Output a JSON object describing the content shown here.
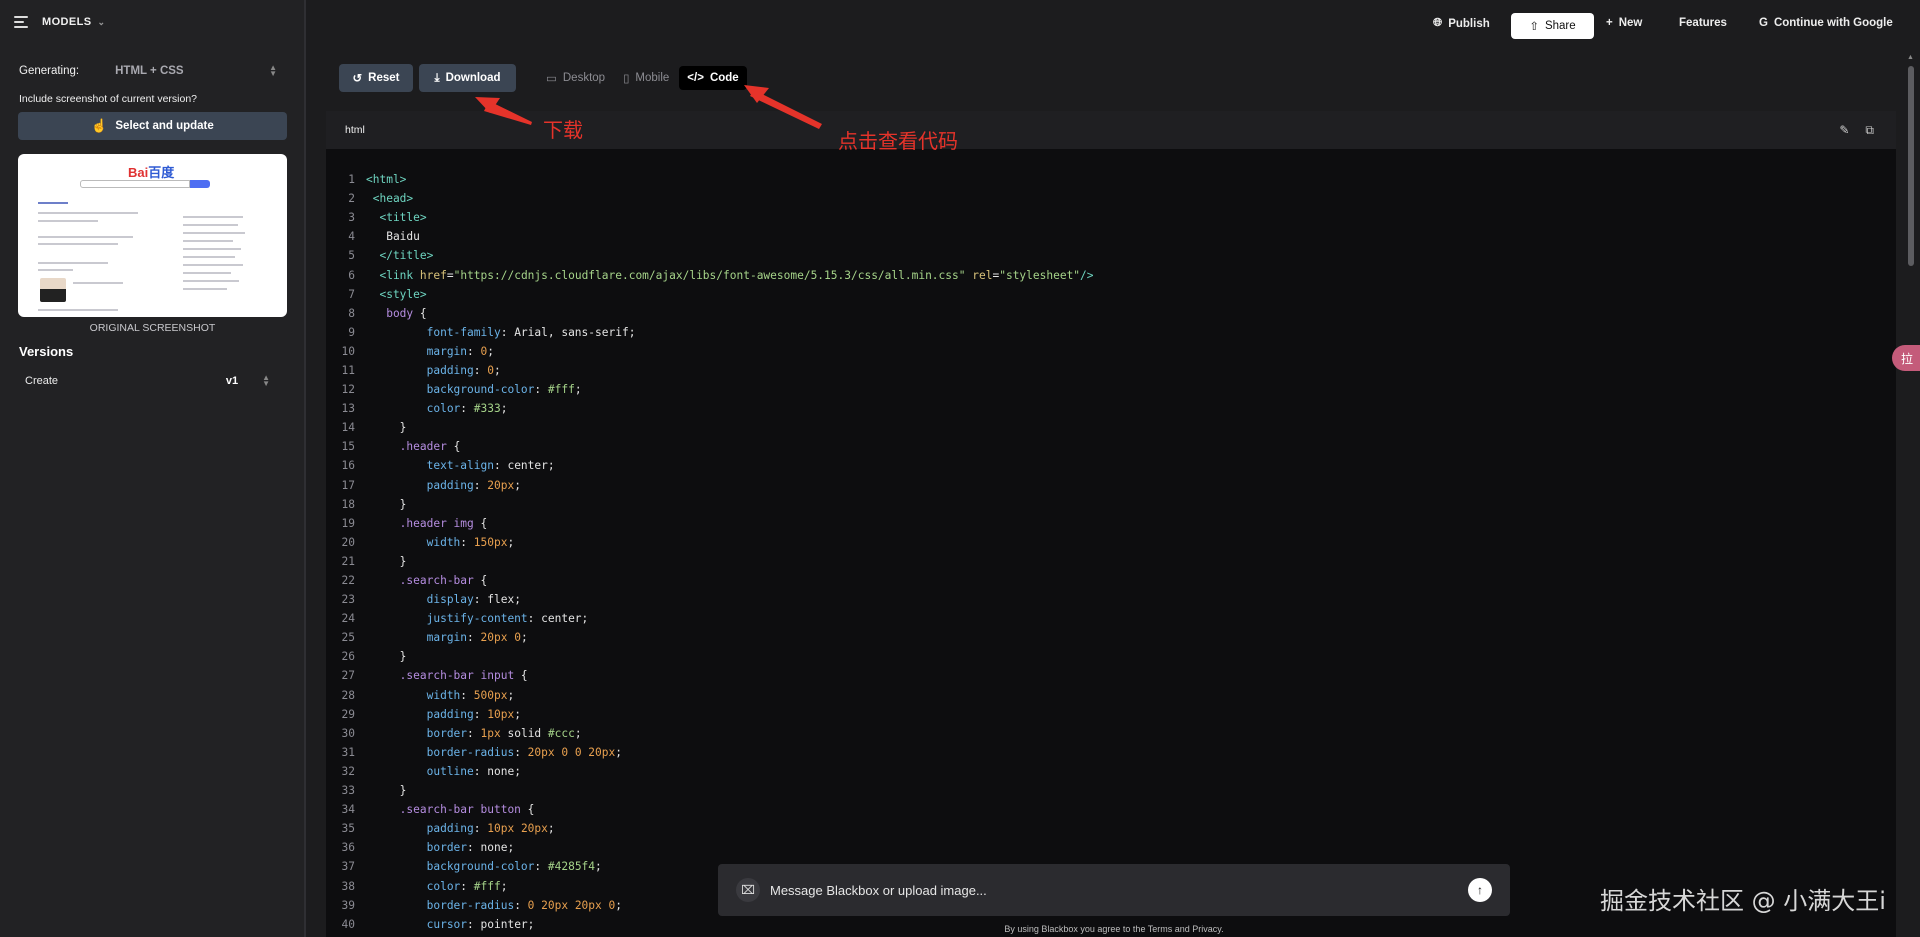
{
  "sidebar": {
    "models_label": "MODELS",
    "generating_label": "Generating:",
    "generating_value": "HTML + CSS",
    "include_prompt": "Include screenshot of current version?",
    "select_update_label": "Select and update",
    "thumbnail_caption": "ORIGINAL SCREENSHOT",
    "versions_heading": "Versions",
    "version_action": "Create",
    "version_number": "v1"
  },
  "topbar": {
    "publish": "Publish",
    "share": "Share",
    "new": "New",
    "features": "Features",
    "google": "Continue with Google"
  },
  "toolbar": {
    "reset": "Reset",
    "download": "Download",
    "tabs": [
      "Desktop",
      "Mobile",
      "Code"
    ],
    "active_tab": "Code"
  },
  "code_panel": {
    "language": "html",
    "lines": [
      [
        [
          "tag",
          "<html>"
        ]
      ],
      [
        [
          "tag",
          " <head>"
        ]
      ],
      [
        [
          "tag",
          "  <title>"
        ]
      ],
      [
        [
          "plain",
          "   Baidu"
        ]
      ],
      [
        [
          "tag",
          "  </title>"
        ]
      ],
      [
        [
          "tag",
          "  <link "
        ],
        [
          "attr",
          "href"
        ],
        [
          "plain",
          "="
        ],
        [
          "str",
          "\"https://cdnjs.cloudflare.com/ajax/libs/font-awesome/5.15.3/css/all.min.css\""
        ],
        [
          "plain",
          " "
        ],
        [
          "attr",
          "rel"
        ],
        [
          "plain",
          "="
        ],
        [
          "str",
          "\"stylesheet\""
        ],
        [
          "tag",
          "/>"
        ]
      ],
      [
        [
          "tag",
          "  <style>"
        ]
      ],
      [
        [
          "sel",
          "   body "
        ],
        [
          "plain",
          "{"
        ]
      ],
      [
        [
          "prop",
          "         font-family"
        ],
        [
          "plain",
          ": Arial, sans-serif;"
        ]
      ],
      [
        [
          "prop",
          "         margin"
        ],
        [
          "plain",
          ": "
        ],
        [
          "num",
          "0"
        ],
        [
          "plain",
          ";"
        ]
      ],
      [
        [
          "prop",
          "         padding"
        ],
        [
          "plain",
          ": "
        ],
        [
          "num",
          "0"
        ],
        [
          "plain",
          ";"
        ]
      ],
      [
        [
          "prop",
          "         background-color"
        ],
        [
          "plain",
          ": "
        ],
        [
          "str",
          "#fff"
        ],
        [
          "plain",
          ";"
        ]
      ],
      [
        [
          "prop",
          "         color"
        ],
        [
          "plain",
          ": "
        ],
        [
          "str",
          "#333"
        ],
        [
          "plain",
          ";"
        ]
      ],
      [
        [
          "plain",
          "     }"
        ]
      ],
      [
        [
          "sel",
          "     .header "
        ],
        [
          "plain",
          "{"
        ]
      ],
      [
        [
          "prop",
          "         text-align"
        ],
        [
          "plain",
          ": center;"
        ]
      ],
      [
        [
          "prop",
          "         padding"
        ],
        [
          "plain",
          ": "
        ],
        [
          "num",
          "20px"
        ],
        [
          "plain",
          ";"
        ]
      ],
      [
        [
          "plain",
          "     }"
        ]
      ],
      [
        [
          "sel",
          "     .header img "
        ],
        [
          "plain",
          "{"
        ]
      ],
      [
        [
          "prop",
          "         width"
        ],
        [
          "plain",
          ": "
        ],
        [
          "num",
          "150px"
        ],
        [
          "plain",
          ";"
        ]
      ],
      [
        [
          "plain",
          "     }"
        ]
      ],
      [
        [
          "sel",
          "     .search-bar "
        ],
        [
          "plain",
          "{"
        ]
      ],
      [
        [
          "prop",
          "         display"
        ],
        [
          "plain",
          ": flex;"
        ]
      ],
      [
        [
          "prop",
          "         justify-content"
        ],
        [
          "plain",
          ": center;"
        ]
      ],
      [
        [
          "prop",
          "         margin"
        ],
        [
          "plain",
          ": "
        ],
        [
          "num",
          "20px 0"
        ],
        [
          "plain",
          ";"
        ]
      ],
      [
        [
          "plain",
          "     }"
        ]
      ],
      [
        [
          "sel",
          "     .search-bar input "
        ],
        [
          "plain",
          "{"
        ]
      ],
      [
        [
          "prop",
          "         width"
        ],
        [
          "plain",
          ": "
        ],
        [
          "num",
          "500px"
        ],
        [
          "plain",
          ";"
        ]
      ],
      [
        [
          "prop",
          "         padding"
        ],
        [
          "plain",
          ": "
        ],
        [
          "num",
          "10px"
        ],
        [
          "plain",
          ";"
        ]
      ],
      [
        [
          "prop",
          "         border"
        ],
        [
          "plain",
          ": "
        ],
        [
          "num",
          "1px"
        ],
        [
          "plain",
          " solid "
        ],
        [
          "str",
          "#ccc"
        ],
        [
          "plain",
          ";"
        ]
      ],
      [
        [
          "prop",
          "         border-radius"
        ],
        [
          "plain",
          ": "
        ],
        [
          "num",
          "20px 0 0 20px"
        ],
        [
          "plain",
          ";"
        ]
      ],
      [
        [
          "prop",
          "         outline"
        ],
        [
          "plain",
          ": none;"
        ]
      ],
      [
        [
          "plain",
          "     }"
        ]
      ],
      [
        [
          "sel",
          "     .search-bar button "
        ],
        [
          "plain",
          "{"
        ]
      ],
      [
        [
          "prop",
          "         padding"
        ],
        [
          "plain",
          ": "
        ],
        [
          "num",
          "10px 20px"
        ],
        [
          "plain",
          ";"
        ]
      ],
      [
        [
          "prop",
          "         border"
        ],
        [
          "plain",
          ": none;"
        ]
      ],
      [
        [
          "prop",
          "         background-color"
        ],
        [
          "plain",
          ": "
        ],
        [
          "str",
          "#4285f4"
        ],
        [
          "plain",
          ";"
        ]
      ],
      [
        [
          "prop",
          "         color"
        ],
        [
          "plain",
          ": "
        ],
        [
          "str",
          "#fff"
        ],
        [
          "plain",
          ";"
        ]
      ],
      [
        [
          "prop",
          "         border-radius"
        ],
        [
          "plain",
          ": "
        ],
        [
          "num",
          "0 20px 20px 0"
        ],
        [
          "plain",
          ";"
        ]
      ],
      [
        [
          "prop",
          "         cursor"
        ],
        [
          "plain",
          ": pointer;"
        ]
      ]
    ]
  },
  "annotations": {
    "download_note": "下载",
    "code_note": "点击查看代码"
  },
  "chat": {
    "placeholder": "Message Blackbox or upload image...",
    "terms": "By using Blackbox you agree to the Terms and Privacy."
  },
  "watermark": "掘金技术社区 @ 小满大王i",
  "side_badge": "拉",
  "colors": {
    "annotation": "#e5332a",
    "button_dark": "#3b4553",
    "background": "#1c1c1e"
  }
}
